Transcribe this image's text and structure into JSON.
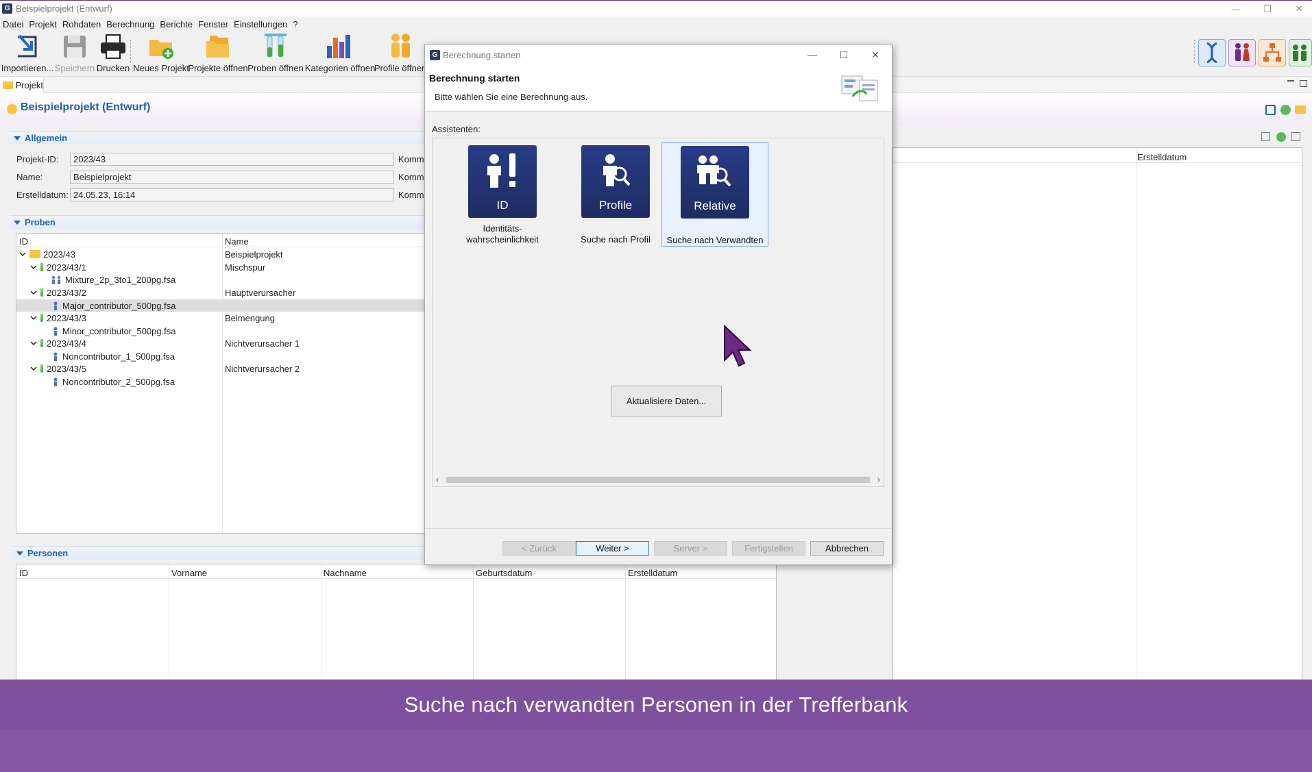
{
  "window": {
    "title": "Beispielprojekt (Entwurf)"
  },
  "menu": [
    "Datei",
    "Projekt",
    "Rohdaten",
    "Berechnung",
    "Berichte",
    "Fenster",
    "Einstellungen",
    "?"
  ],
  "toolbar": {
    "import": "Importieren...",
    "save": "Speichern",
    "print": "Drucken",
    "new_project": "Neues Projekt",
    "open_projects": "Projekte öffnen",
    "open_samples": "Proben öffnen",
    "open_categories": "Kategorien öffnen",
    "open_profiles": "Profile öffnen"
  },
  "project_tab": "Projekt",
  "project_title": "Beispielprojekt (Entwurf)",
  "general": {
    "section": "Allgemein",
    "id_label": "Projekt-ID:",
    "id_value": "2023/43",
    "name_label": "Name:",
    "name_value": "Beispielprojekt",
    "date_label": "Erstelldatum:",
    "date_value": "24.05.23, 16:14",
    "comment_label": "Komme"
  },
  "samples": {
    "section": "Proben",
    "headers": [
      "ID",
      "Name"
    ],
    "rows": [
      {
        "id": "2023/43",
        "name": "Beispielprojekt"
      },
      {
        "id": "2023/43/1",
        "name": "Mischspur"
      },
      {
        "id": "Mixture_2p_3to1_200pg.fsa",
        "name": ""
      },
      {
        "id": "2023/43/2",
        "name": "Hauptverursacher"
      },
      {
        "id": "Major_contributor_500pg.fsa",
        "name": ""
      },
      {
        "id": "2023/43/3",
        "name": "Beimengung"
      },
      {
        "id": "Minor_contributor_500pg.fsa",
        "name": ""
      },
      {
        "id": "2023/43/4",
        "name": "Nichtverursacher 1"
      },
      {
        "id": "Noncontributor_1_500pg.fsa",
        "name": ""
      },
      {
        "id": "2023/43/5",
        "name": "Nichtverursacher 2"
      },
      {
        "id": "Noncontributor_2_500pg.fsa",
        "name": ""
      }
    ]
  },
  "persons": {
    "section": "Personen",
    "headers": [
      "ID",
      "Vorname",
      "Nachname",
      "Geburtsdatum",
      "Erstelldatum"
    ]
  },
  "right_panel": {
    "header": "Erstelldatum"
  },
  "dialog": {
    "window_title": "Berechnung starten",
    "heading": "Berechnung starten",
    "subtitle": "Bitte wählen Sie eine Berechnung aus.",
    "assistants_label": "Assistenten:",
    "wizards": [
      {
        "tile": "ID",
        "caption1": "Identitäts-",
        "caption2": "wahrscheinlichkeit"
      },
      {
        "tile": "Profile",
        "caption1": "Suche nach Profil",
        "caption2": ""
      },
      {
        "tile": "Relative",
        "caption1": "Suche nach Verwandten",
        "caption2": ""
      }
    ],
    "refresh": "Aktualisiere Daten...",
    "buttons": {
      "back": "< Zurück",
      "next": "Weiter >",
      "server": "Server >",
      "finish": "Fertigstellen",
      "cancel": "Abbrechen"
    }
  },
  "caption": "Suche nach verwandten Personen in der Trefferbank",
  "colors": {
    "accent_blue": "#2462a8",
    "tile_dark_blue": "#1e2c63",
    "caption_purple": "#744296",
    "cursor_purple": "#6a2a86"
  }
}
